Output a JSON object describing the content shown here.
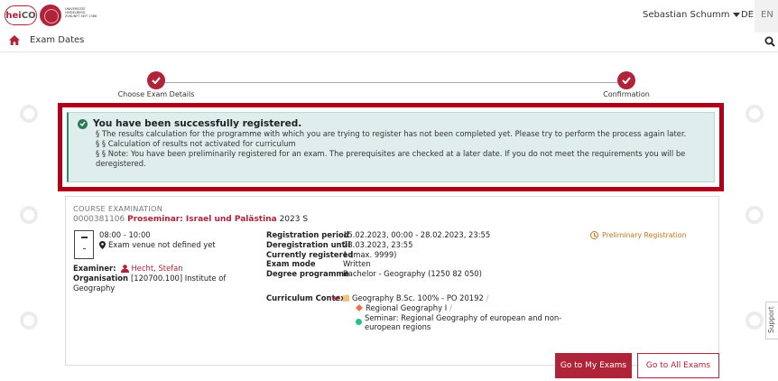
{
  "header": {
    "logo_text": "heiCO",
    "university_text": "UNIVERSITÄT HEIDELBERG ZUKUNFT SEIT 1386",
    "user_name": "Sebastian Schumm",
    "languages": [
      "DE",
      "EN"
    ]
  },
  "breadcrumb": {
    "title": "Exam Dates"
  },
  "stepper": {
    "steps": [
      {
        "label": "Choose Exam Details"
      },
      {
        "label": "Confirmation"
      }
    ]
  },
  "alert": {
    "title": "You have been successfully registered.",
    "lines": [
      "§ The results calculation for the programme with which you are trying to register has not been completed yet. Please try to perform the process again later.",
      "§ § Calculation of results not activated for curriculum",
      "§ § Note: You have been preliminarily registered for an exam. The prerequisites are checked at a later date. If you do not meet the requirements you will be",
      "deregistered."
    ]
  },
  "exam": {
    "kind": "COURSE EXAMINATION",
    "number": "0000381106",
    "name": "Proseminar: Israel und Palästina",
    "term": "2023 S",
    "time": "08:00 - 10:00",
    "venue": "Exam venue not defined yet",
    "examiner_label": "Examiner:",
    "examiner": "Hecht, Stefan",
    "organisation_label": "Organisation",
    "organisation": "[120700.100] Institute of Geography",
    "details": [
      {
        "key": "Registration period",
        "value": "15.02.2023, 00:00 - 28.02.2023, 23:55"
      },
      {
        "key": "Deregistration until",
        "value": "28.03.2023, 23:55"
      },
      {
        "key": "Currently registered",
        "value": "1 (max. 9999)"
      },
      {
        "key": "Exam mode",
        "value": "Written"
      },
      {
        "key": "Degree programme",
        "value": "Bachelor - Geography (1250 82 050)"
      }
    ],
    "curriculum_label": "Curriculum Context",
    "curriculum": [
      {
        "text": "Geography B.Sc. 100% - PO 20192",
        "sep": "/"
      },
      {
        "text": "Regional Geography I",
        "sep": "/"
      },
      {
        "text": "Seminar: Regional Geography of european and non-european regions",
        "sep": ""
      }
    ],
    "status": "Preliminary Registration"
  },
  "buttons": {
    "my_exams": "Go to My Exams",
    "all_exams": "Go to All Exams"
  },
  "support_label": "Support",
  "colors": {
    "brand": "#b0243a",
    "success": "#2a7a55",
    "warning": "#c07a18",
    "highlight_frame": "#b0001a"
  }
}
